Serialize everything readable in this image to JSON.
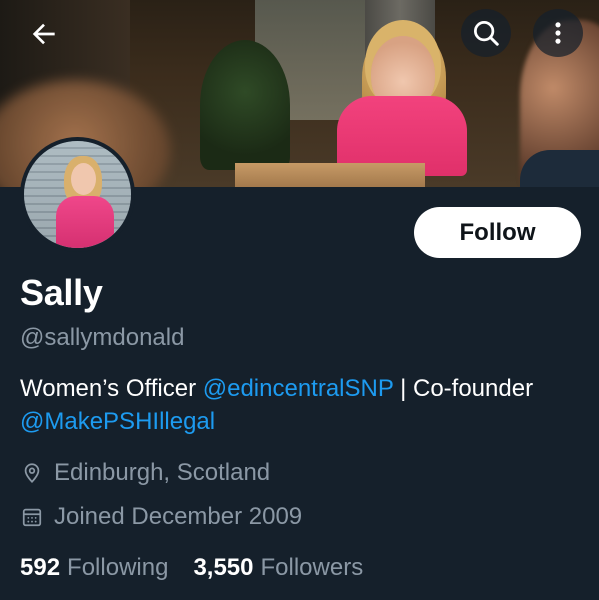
{
  "header": {
    "back_icon": "arrow-left-icon",
    "search_icon": "search-icon",
    "more_icon": "more-vertical-icon"
  },
  "profile": {
    "name": "Sally",
    "handle": "@sallymdonald",
    "follow_label": "Follow",
    "bio": {
      "part1": "Women’s Officer ",
      "link1": "@edincentralSNP",
      "part2": " | Co-founder ",
      "link2": "@MakePSHIllegal"
    },
    "location": "Edinburgh, Scotland",
    "joined": "Joined December 2009",
    "following_count": "592",
    "following_label": "Following",
    "followers_count": "3,550",
    "followers_label": "Followers"
  },
  "colors": {
    "background": "#15202b",
    "accent": "#1d9bf0",
    "secondary_text": "#8b98a5"
  }
}
